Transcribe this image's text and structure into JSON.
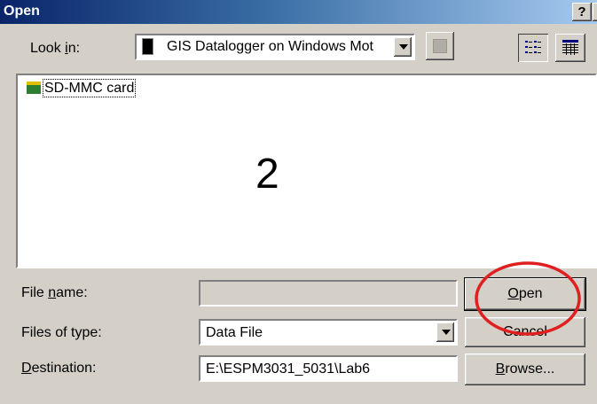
{
  "window": {
    "title": "Open",
    "help_label": "?",
    "close_label": "×"
  },
  "look_in": {
    "label_prefix": "Look ",
    "label_underlined": "i",
    "label_suffix": "n:",
    "value": "GIS Datalogger on Windows Mot"
  },
  "file_list": {
    "items": [
      {
        "label": "SD-MMC card",
        "icon": "storage-card-icon"
      }
    ],
    "annotation": "2"
  },
  "fields": {
    "file_name": {
      "label_prefix": "File ",
      "label_underlined": "n",
      "label_suffix": "ame:",
      "value": ""
    },
    "file_type": {
      "label": "Files of type:",
      "value": "Data File"
    },
    "destination": {
      "label_underlined": "D",
      "label_suffix": "estination:",
      "value": "E:\\ESPM3031_5031\\Lab6"
    }
  },
  "buttons": {
    "open": {
      "underlined": "O",
      "rest": "pen"
    },
    "cancel": "Cancel",
    "browse": {
      "underlined": "B",
      "rest": "rowse..."
    }
  },
  "colors": {
    "highlight_circle": "#e02020",
    "titlebar_start": "#0a246a",
    "dialog_bg": "#d4d0c8"
  }
}
